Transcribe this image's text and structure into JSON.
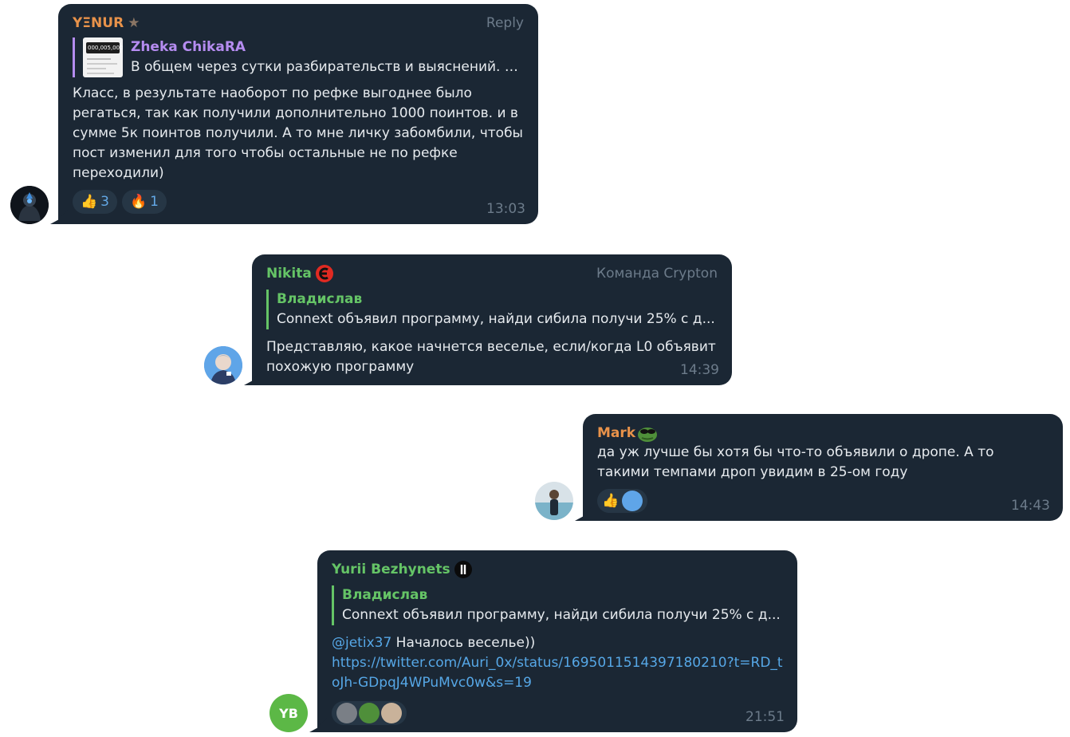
{
  "messages": [
    {
      "sender": "YΞNUR",
      "role": "Reply",
      "reply_name": "Zheka ChikaRA",
      "reply_text": "В общем через сутки разбирательств и выяснений. А...",
      "text": "Класс, в результате наоборот по рефке выгоднее было регаться, так как получили дополнительно 1000 поинтов. и в сумме 5к поинтов получили. А то мне личку забомбили, чтобы пост изменил для того чтобы остальные не по рефке переходили)",
      "reactions": [
        {
          "icon": "thumbs-up",
          "count": "3"
        },
        {
          "icon": "fire",
          "count": "1"
        }
      ],
      "time": "13:03",
      "thumb_text": "000,005,000"
    },
    {
      "sender": "Nikita",
      "role": "Команда Crypton",
      "reply_name": "Владислав",
      "reply_text": "Connext объявил программу, найди сибила получи 25% с д...",
      "text": "Представляю, какое начнется веселье, если/когда L0 объявит похожую программу",
      "time": "14:39"
    },
    {
      "sender": "Mark",
      "text": "да уж лучше бы хотя бы что-то объявили о дропе. А то такими темпами дроп увидим в 25-ом году",
      "time": "14:43"
    },
    {
      "sender": "Yurii Bezhynets",
      "reply_name": "Владислав",
      "reply_text": "Connext объявил программу, найди сибила получи 25% с д...",
      "mention": "@jetix37",
      "text_after_mention": " Началось веселье))",
      "link": "https://twitter.com/Auri_0x/status/1695011514397180210?t=RD_toJh-GDpqJ4WPuMvc0w&s=19",
      "time": "21:51",
      "avatar_initials": "YB"
    }
  ],
  "colors": {
    "bubble": "#1b2734",
    "yernur": "#e8924a",
    "zheka": "#b58cf0",
    "green": "#65c466",
    "mark": "#e8924a",
    "link": "#56a7e6",
    "time": "#6c7b8a"
  }
}
